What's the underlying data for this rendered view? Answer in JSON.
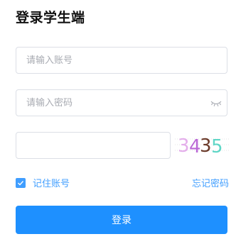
{
  "form": {
    "title": "登录学生端",
    "account_placeholder": "请输入账号",
    "password_placeholder": "请输入密码",
    "captcha_value": "",
    "captcha_text": "3435",
    "remember_label": "记住账号",
    "remember_checked": true,
    "forgot_label": "忘记密码",
    "login_label": "登录"
  },
  "colors": {
    "accent": "#409eff",
    "button": "#1e90ff"
  },
  "icons": {
    "password_toggle": "eye-closed-icon",
    "checkbox": "check-icon"
  }
}
